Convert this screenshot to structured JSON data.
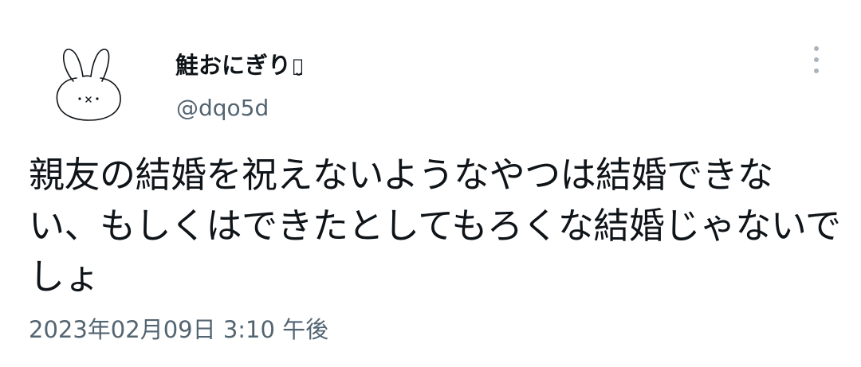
{
  "author": {
    "display_name": "鮭おにぎり",
    "name_emoji": "ꪔ̤̮",
    "handle": "@dqo5d",
    "avatar_icon": "bunny-drawing-icon"
  },
  "menu": {
    "icon": "more-vertical-icon"
  },
  "tweet": {
    "text": "親友の結婚を祝えないようなやつは結婚できない、もしくはできたとしてもろくな結婚じゃないでしょ",
    "timestamp": "2023年02月09日 3:10 午後"
  },
  "colors": {
    "text_primary": "#0f1419",
    "text_secondary": "#536471",
    "menu_dots": "#a9b4bd"
  }
}
